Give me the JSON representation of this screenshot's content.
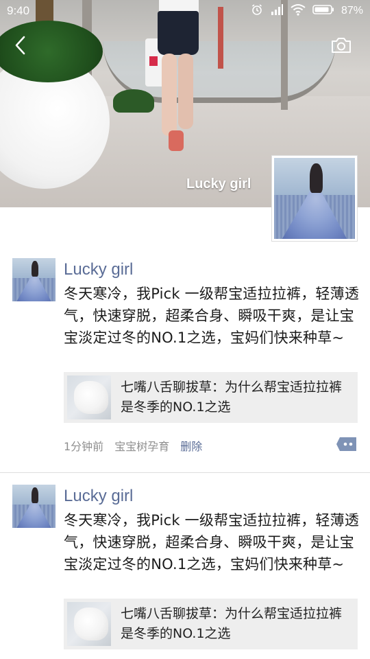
{
  "status_bar": {
    "time": "9:40",
    "battery": "87%",
    "icons": [
      "alarm-icon",
      "hd-signal-icon",
      "wifi-icon",
      "battery-icon"
    ]
  },
  "header": {
    "back_icon": "chevron-left-icon",
    "camera_icon": "camera-icon",
    "cover_name": "Lucky girl"
  },
  "posts": [
    {
      "author": "Lucky girl",
      "text": "冬天寒冷，我Pick 一级帮宝适拉拉裤，轻薄透气，快速穿脱，超柔合身、瞬吸干爽，是让宝宝淡定过冬的NO.1之选，宝妈们快来种草~",
      "link_title": "七嘴八舌聊拔草：为什么帮宝适拉拉裤是冬季的NO.1之选",
      "time": "1分钟前",
      "source": "宝宝树孕育",
      "delete": "删除"
    },
    {
      "author": "Lucky girl",
      "text": "冬天寒冷，我Pick 一级帮宝适拉拉裤，轻薄透气，快速穿脱，超柔合身、瞬吸干爽，是让宝宝淡定过冬的NO.1之选，宝妈们快来种草~",
      "link_title": "七嘴八舌聊拔草：为什么帮宝适拉拉裤是冬季的NO.1之选"
    }
  ],
  "colors": {
    "link_name": "#5a6c96",
    "meta_gray": "#8f8f8f",
    "link_card_bg": "#eeeeee"
  }
}
